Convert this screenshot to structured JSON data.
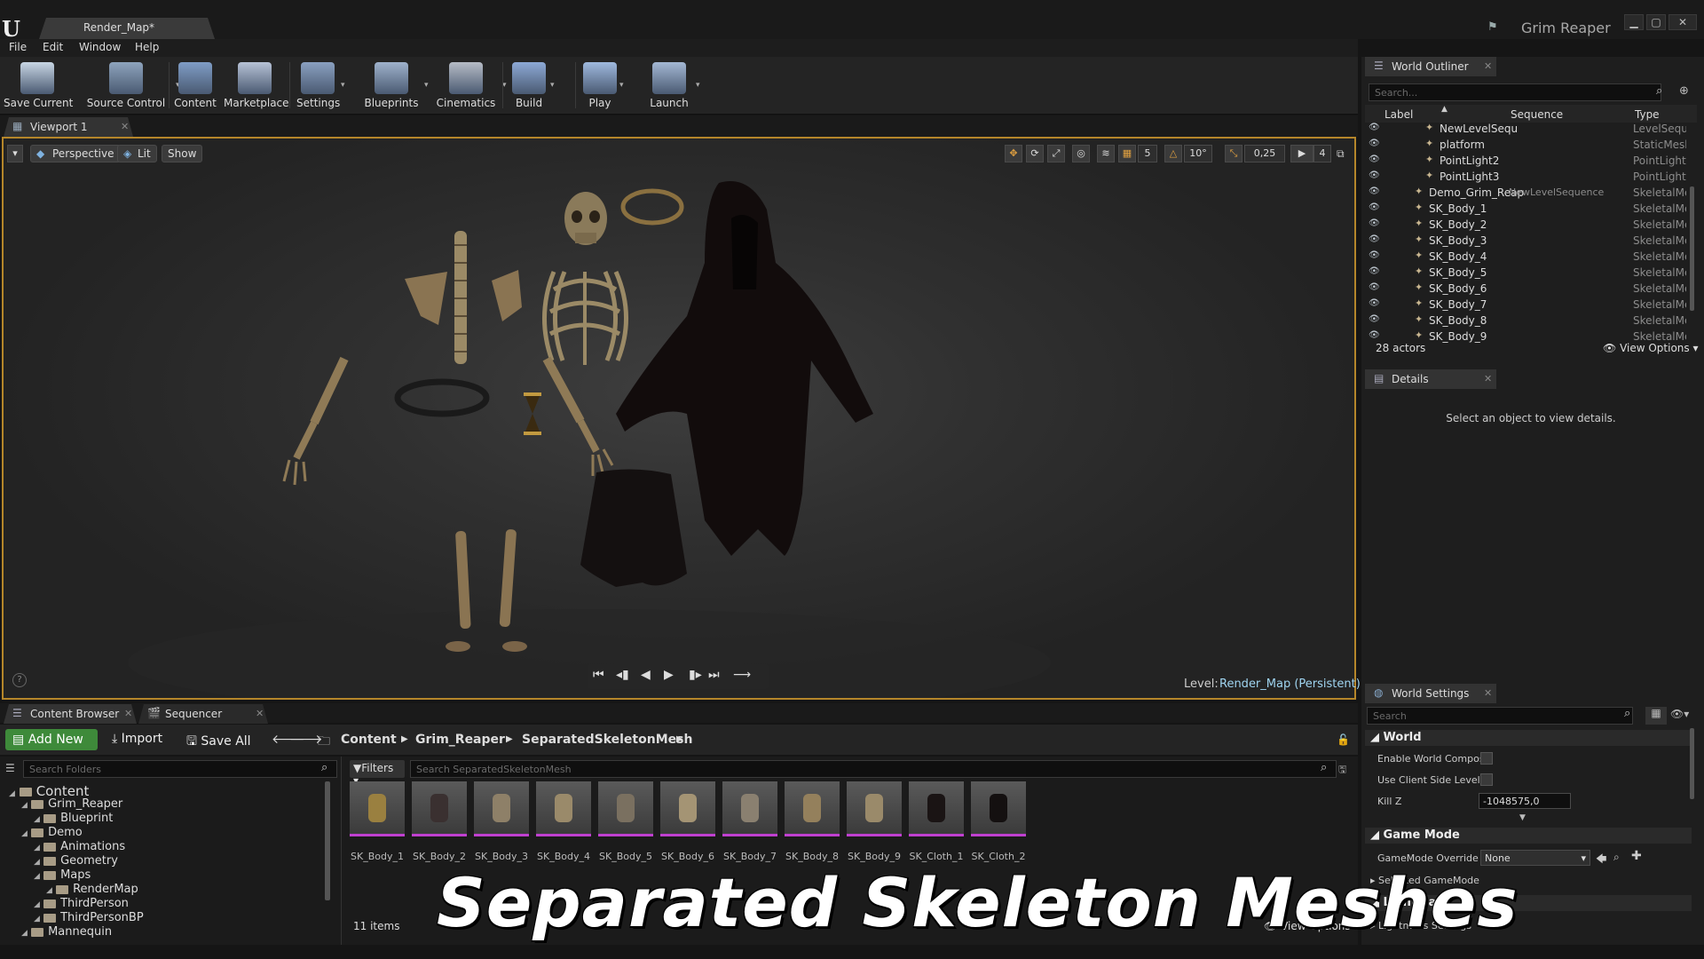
{
  "window": {
    "doc_tab": "Render_Map*",
    "project_name": "Grim Reaper",
    "min": "▁",
    "max": "▢",
    "close": "✕"
  },
  "menu": [
    "File",
    "Edit",
    "Window",
    "Help"
  ],
  "toolbar": [
    {
      "label": "Save Current",
      "icon": "save-icon",
      "color": "#c8d6e4"
    },
    {
      "label": "Source Control",
      "icon": "source-control-icon",
      "color": "#8ea4bd"
    },
    {
      "label": "Content",
      "icon": "content-icon",
      "color": "#7f9dc6"
    },
    {
      "label": "Marketplace",
      "icon": "marketplace-icon",
      "color": "#b7c2d6"
    },
    {
      "label": "Settings",
      "icon": "settings-icon",
      "color": "#8aa0c0"
    },
    {
      "label": "Blueprints",
      "icon": "blueprints-icon",
      "color": "#9fb2cc"
    },
    {
      "label": "Cinematics",
      "icon": "cinematics-icon",
      "color": "#b6bcc6"
    },
    {
      "label": "Build",
      "icon": "build-icon",
      "color": "#8da9d6"
    },
    {
      "label": "Play",
      "icon": "play-icon",
      "color": "#9fb9de"
    },
    {
      "label": "Launch",
      "icon": "launch-icon",
      "color": "#a4b8d4"
    }
  ],
  "viewport": {
    "tab": "Viewport 1",
    "perspective": "Perspective",
    "lit": "Lit",
    "show": "Show",
    "grid_snap": "5",
    "rot_snap": "10°",
    "scale_snap": "0,25",
    "cam_speed": "4",
    "level_label": "Level:",
    "level_value": "Render_Map (Persistent)",
    "help": "?"
  },
  "outliner": {
    "tab": "World Outliner",
    "search_placeholder": "Search...",
    "col_label": "Label",
    "col_sequence": "Sequence",
    "col_type": "Type",
    "rows": [
      {
        "name": "NewLevelSequ",
        "seq": "",
        "type": "LevelSequ"
      },
      {
        "name": "platform",
        "seq": "",
        "type": "StaticMesh"
      },
      {
        "name": "PointLight2",
        "seq": "",
        "type": "PointLight"
      },
      {
        "name": "PointLight3",
        "seq": "",
        "type": "PointLight"
      },
      {
        "name": "Demo_Grim_Reap",
        "seq": "NewLevelSequence",
        "type": "SkeletalMe"
      },
      {
        "name": "SK_Body_1",
        "seq": "",
        "type": "SkeletalMe"
      },
      {
        "name": "SK_Body_2",
        "seq": "",
        "type": "SkeletalMe"
      },
      {
        "name": "SK_Body_3",
        "seq": "",
        "type": "SkeletalMe"
      },
      {
        "name": "SK_Body_4",
        "seq": "",
        "type": "SkeletalMe"
      },
      {
        "name": "SK_Body_5",
        "seq": "",
        "type": "SkeletalMe"
      },
      {
        "name": "SK_Body_6",
        "seq": "",
        "type": "SkeletalMe"
      },
      {
        "name": "SK_Body_7",
        "seq": "",
        "type": "SkeletalMe"
      },
      {
        "name": "SK_Body_8",
        "seq": "",
        "type": "SkeletalMe"
      },
      {
        "name": "SK_Body_9",
        "seq": "",
        "type": "SkeletalMe"
      }
    ],
    "actor_count": "28 actors",
    "view_options": "View Options"
  },
  "details": {
    "tab": "Details",
    "empty": "Select an object to view details."
  },
  "world_settings": {
    "tab": "World Settings",
    "search_placeholder": "Search",
    "world_section": "World",
    "enable_world_comp": "Enable World Composi",
    "use_client_side": "Use Client Side Level S",
    "kill_z_label": "Kill Z",
    "kill_z_value": "-1048575,0",
    "game_mode_section": "Game Mode",
    "game_mode_override": "GameMode Override",
    "game_mode_value": "None",
    "selected_game_mode": "Selected GameMode",
    "lightmass_section": "Lightmass",
    "lightmass_settings": "Lightmass Settings"
  },
  "content_browser": {
    "tab1": "Content Browser",
    "tab2": "Sequencer",
    "add_new": "Add New",
    "import": "Import",
    "save_all": "Save All",
    "breadcrumbs": [
      "Content",
      "Grim_Reaper",
      "SeparatedSkeletonMesh"
    ],
    "search_folders": "Search Folders",
    "filters": "Filters",
    "search_assets": "Search SeparatedSkeletonMesh",
    "tree": [
      {
        "label": "Content",
        "depth": 0
      },
      {
        "label": "Grim_Reaper",
        "depth": 1
      },
      {
        "label": "Blueprint",
        "depth": 2
      },
      {
        "label": "Demo",
        "depth": 1
      },
      {
        "label": "Animations",
        "depth": 2
      },
      {
        "label": "Geometry",
        "depth": 2
      },
      {
        "label": "Maps",
        "depth": 2
      },
      {
        "label": "RenderMap",
        "depth": 3
      },
      {
        "label": "ThirdPerson",
        "depth": 2
      },
      {
        "label": "ThirdPersonBP",
        "depth": 2
      },
      {
        "label": "Mannequin",
        "depth": 1
      }
    ],
    "assets": [
      "SK_Body_1",
      "SK_Body_2",
      "SK_Body_3",
      "SK_Body_4",
      "SK_Body_5",
      "SK_Body_6",
      "SK_Body_7",
      "SK_Body_8",
      "SK_Body_9",
      "SK_Cloth_1",
      "SK_Cloth_2"
    ],
    "item_count": "11 items",
    "view_options": "View Options"
  },
  "overlay_title": "Separated Skeleton Meshes",
  "colors": {
    "accent_border": "#b5862a",
    "add_new_green": "#3e8a3a",
    "level_link": "#9fd4f0",
    "asset_underline": "#c040d0"
  }
}
